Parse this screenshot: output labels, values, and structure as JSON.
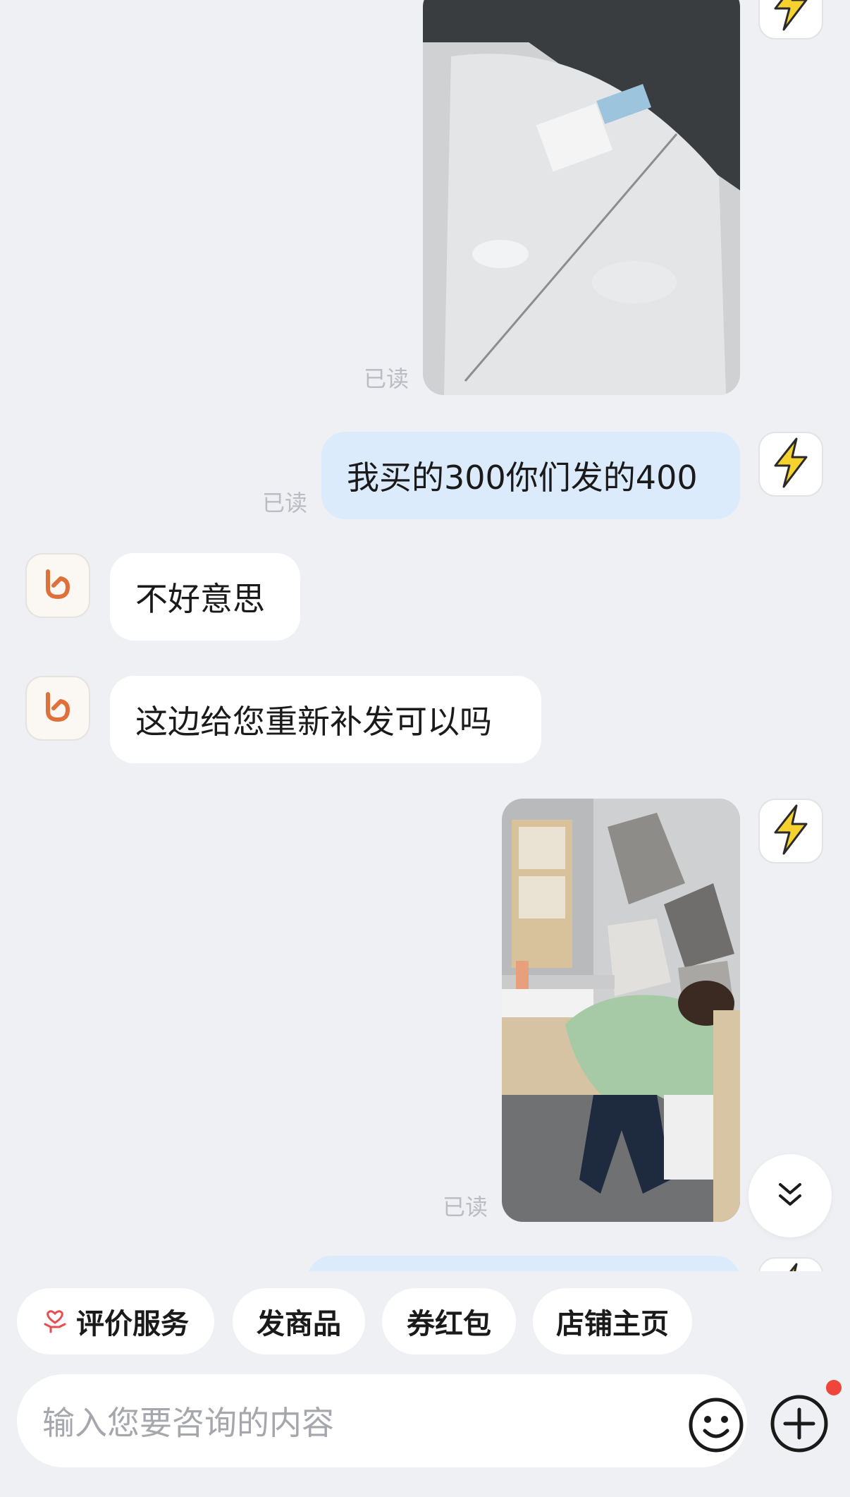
{
  "messages": {
    "msg1": {
      "read_status": "已读"
    },
    "msg2": {
      "text": "我买的300你们发的400",
      "read_status": "已读"
    },
    "msg3": {
      "text": "不好意思"
    },
    "msg4": {
      "text": "这边给您重新补发可以吗"
    },
    "msg5": {
      "read_status": "已读"
    }
  },
  "quick_actions": [
    {
      "label": "评价服务",
      "icon": "heart-hand-icon"
    },
    {
      "label": "发商品"
    },
    {
      "label": "券红包"
    },
    {
      "label": "店铺主页"
    }
  ],
  "composer": {
    "placeholder": "输入您要咨询的内容",
    "emoji_icon": "smiley-icon",
    "plus_icon": "plus-circle-icon",
    "has_notification_dot": true
  },
  "colors": {
    "background": "#eff0f4",
    "my_bubble": "#dcebfb",
    "their_bubble": "#ffffff",
    "shop_logo": "#e0703a",
    "user_avatar_bolt": "#f5d22e",
    "notification_dot": "#f0453a"
  }
}
